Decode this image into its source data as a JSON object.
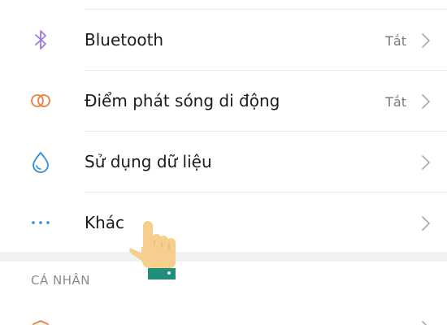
{
  "settings": {
    "items": [
      {
        "label": "Bluetooth",
        "value": "Tắt",
        "icon": "bluetooth-icon"
      },
      {
        "label": "Điểm phát sóng di động",
        "value": "Tắt",
        "icon": "hotspot-icon"
      },
      {
        "label": "Sử dụng dữ liệu",
        "value": "",
        "icon": "data-usage-icon"
      },
      {
        "label": "Khác",
        "value": "",
        "icon": "more-icon"
      }
    ],
    "section_personal": "CÁ NHÂN"
  },
  "colors": {
    "bluetooth": "#9b7be0",
    "hotspot": "#e8823c",
    "data": "#2f8ad8",
    "more": "#2f8ad8",
    "personal": "#e8823c",
    "hand_skin": "#f6cf8e",
    "hand_cuff": "#1f8f7a"
  }
}
